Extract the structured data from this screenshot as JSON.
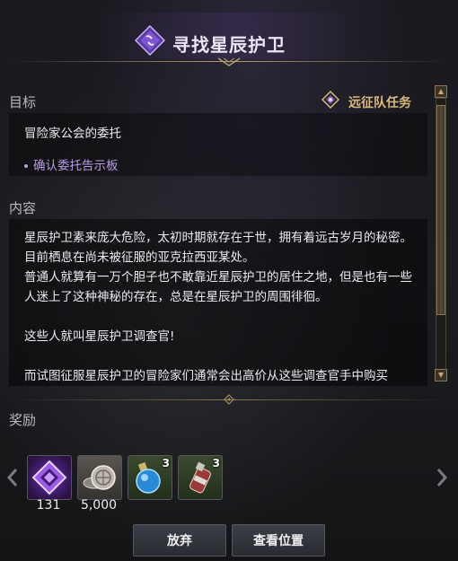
{
  "header": {
    "title": "寻找星辰护卫",
    "icon": "quest-chain-icon"
  },
  "goal": {
    "label": "目标",
    "task_type": "远征队任务",
    "task_type_icon": "expedition-icon",
    "description": "冒险家公会的委托",
    "objective": "确认委托告示板"
  },
  "content": {
    "label": "内容",
    "lines": [
      "星辰护卫素来庞大危险，太初时期就存在于世，拥有着远古岁月的秘密。目前栖息在尚未被征服的亚克拉西亚某处。",
      "普通人就算有一万个胆子也不敢靠近星辰护卫的居住之地，但是也有一些人迷上了这种神秘的存在，总是在星辰护卫的周围徘徊。",
      "",
      "这些人就叫星辰护卫调查官!",
      "",
      "而试图征服星辰护卫的冒险家们通常会出高价从这些调查官手中购买"
    ]
  },
  "rewards": {
    "label": "奖励",
    "items": [
      {
        "name": "purple-crystal-icon",
        "quantity": "131",
        "stack": ""
      },
      {
        "name": "silver-coins-icon",
        "quantity": "5,000",
        "stack": ""
      },
      {
        "name": "blue-potion-icon",
        "quantity": "",
        "stack": "3"
      },
      {
        "name": "grenade-icon",
        "quantity": "",
        "stack": "3"
      }
    ]
  },
  "buttons": {
    "abandon": "放弃",
    "view_location": "查看位置"
  },
  "colors": {
    "accent_gold": "#d8bb7c",
    "objective_purple": "#b89de6"
  }
}
